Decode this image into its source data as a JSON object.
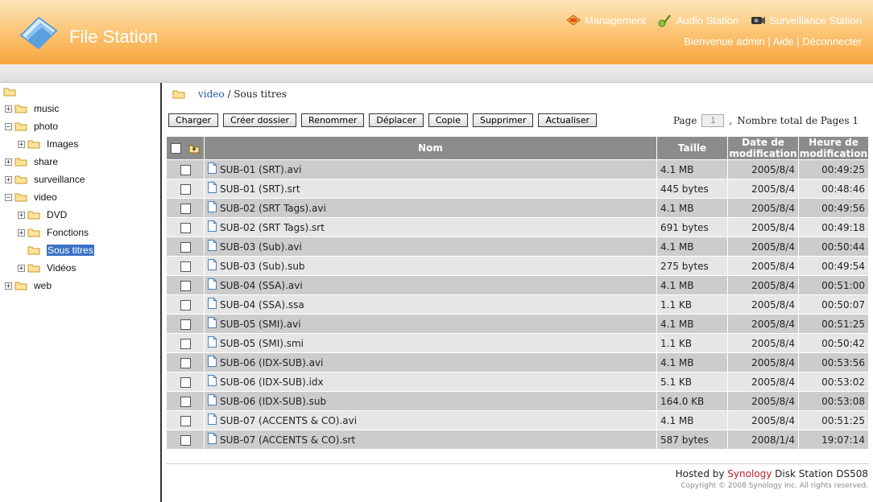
{
  "header": {
    "app_title": "File Station",
    "nav": [
      {
        "label": "Management",
        "icon": "management-icon"
      },
      {
        "label": "Audio Station",
        "icon": "audio-icon"
      },
      {
        "label": "Surveillance Station",
        "icon": "camera-icon"
      }
    ],
    "user": {
      "welcome": "Bienvenue admin",
      "help": "Aide",
      "logout": "Déconnecter",
      "sep": "|"
    }
  },
  "tree": {
    "items": [
      {
        "label": "music",
        "level": 0,
        "toggle": "+"
      },
      {
        "label": "photo",
        "level": 0,
        "toggle": "−"
      },
      {
        "label": "Images",
        "level": 1,
        "toggle": "+"
      },
      {
        "label": "share",
        "level": 0,
        "toggle": "+"
      },
      {
        "label": "surveillance",
        "level": 0,
        "toggle": "+"
      },
      {
        "label": "video",
        "level": 0,
        "toggle": "−"
      },
      {
        "label": "DVD",
        "level": 1,
        "toggle": "+"
      },
      {
        "label": "Fonctions",
        "level": 1,
        "toggle": "+"
      },
      {
        "label": "Sous titres",
        "level": 1,
        "toggle": "",
        "selected": true
      },
      {
        "label": "Vidéos",
        "level": 1,
        "toggle": "+"
      },
      {
        "label": "web",
        "level": 0,
        "toggle": "+"
      }
    ]
  },
  "breadcrumb": {
    "link": "video",
    "rest": " / Sous titres"
  },
  "toolbar": {
    "buttons": [
      "Charger",
      "Créer dossier",
      "Renommer",
      "Déplacer",
      "Copie",
      "Supprimer",
      "Actualiser"
    ]
  },
  "pager": {
    "label": "Page",
    "value": "1",
    "sep": ",",
    "total_label": "Nombre total de Pages 1"
  },
  "table": {
    "headers": {
      "name": "Nom",
      "size": "Taille",
      "date": "Date de modification",
      "time": "Heure de modification"
    },
    "rows": [
      {
        "name": "SUB-01 (SRT).avi",
        "size": "4.1 MB",
        "date": "2005/8/4",
        "time": "00:49:25"
      },
      {
        "name": "SUB-01 (SRT).srt",
        "size": "445 bytes",
        "date": "2005/8/4",
        "time": "00:48:46"
      },
      {
        "name": "SUB-02 (SRT Tags).avi",
        "size": "4.1 MB",
        "date": "2005/8/4",
        "time": "00:49:56"
      },
      {
        "name": "SUB-02 (SRT Tags).srt",
        "size": "691 bytes",
        "date": "2005/8/4",
        "time": "00:49:18"
      },
      {
        "name": "SUB-03 (Sub).avi",
        "size": "4.1 MB",
        "date": "2005/8/4",
        "time": "00:50:44"
      },
      {
        "name": "SUB-03 (Sub).sub",
        "size": "275 bytes",
        "date": "2005/8/4",
        "time": "00:49:54"
      },
      {
        "name": "SUB-04 (SSA).avi",
        "size": "4.1 MB",
        "date": "2005/8/4",
        "time": "00:51:00"
      },
      {
        "name": "SUB-04 (SSA).ssa",
        "size": "1.1 KB",
        "date": "2005/8/4",
        "time": "00:50:07"
      },
      {
        "name": "SUB-05 (SMI).avi",
        "size": "4.1 MB",
        "date": "2005/8/4",
        "time": "00:51:25"
      },
      {
        "name": "SUB-05 (SMI).smi",
        "size": "1.1 KB",
        "date": "2005/8/4",
        "time": "00:50:42"
      },
      {
        "name": "SUB-06 (IDX-SUB).avi",
        "size": "4.1 MB",
        "date": "2005/8/4",
        "time": "00:53:56"
      },
      {
        "name": "SUB-06 (IDX-SUB).idx",
        "size": "5.1 KB",
        "date": "2005/8/4",
        "time": "00:53:02"
      },
      {
        "name": "SUB-06 (IDX-SUB).sub",
        "size": "164.0 KB",
        "date": "2005/8/4",
        "time": "00:53:08"
      },
      {
        "name": "SUB-07 (ACCENTS & CO).avi",
        "size": "4.1 MB",
        "date": "2005/8/4",
        "time": "00:51:25"
      },
      {
        "name": "SUB-07 (ACCENTS & CO).srt",
        "size": "587 bytes",
        "date": "2008/1/4",
        "time": "19:07:14"
      }
    ]
  },
  "footer": {
    "hosted_prefix": "Hosted by ",
    "brand": "Synology",
    "hosted_suffix": " Disk Station DS508",
    "copyright": "Copyright © 2008 Synology Inc. All rights reserved."
  }
}
